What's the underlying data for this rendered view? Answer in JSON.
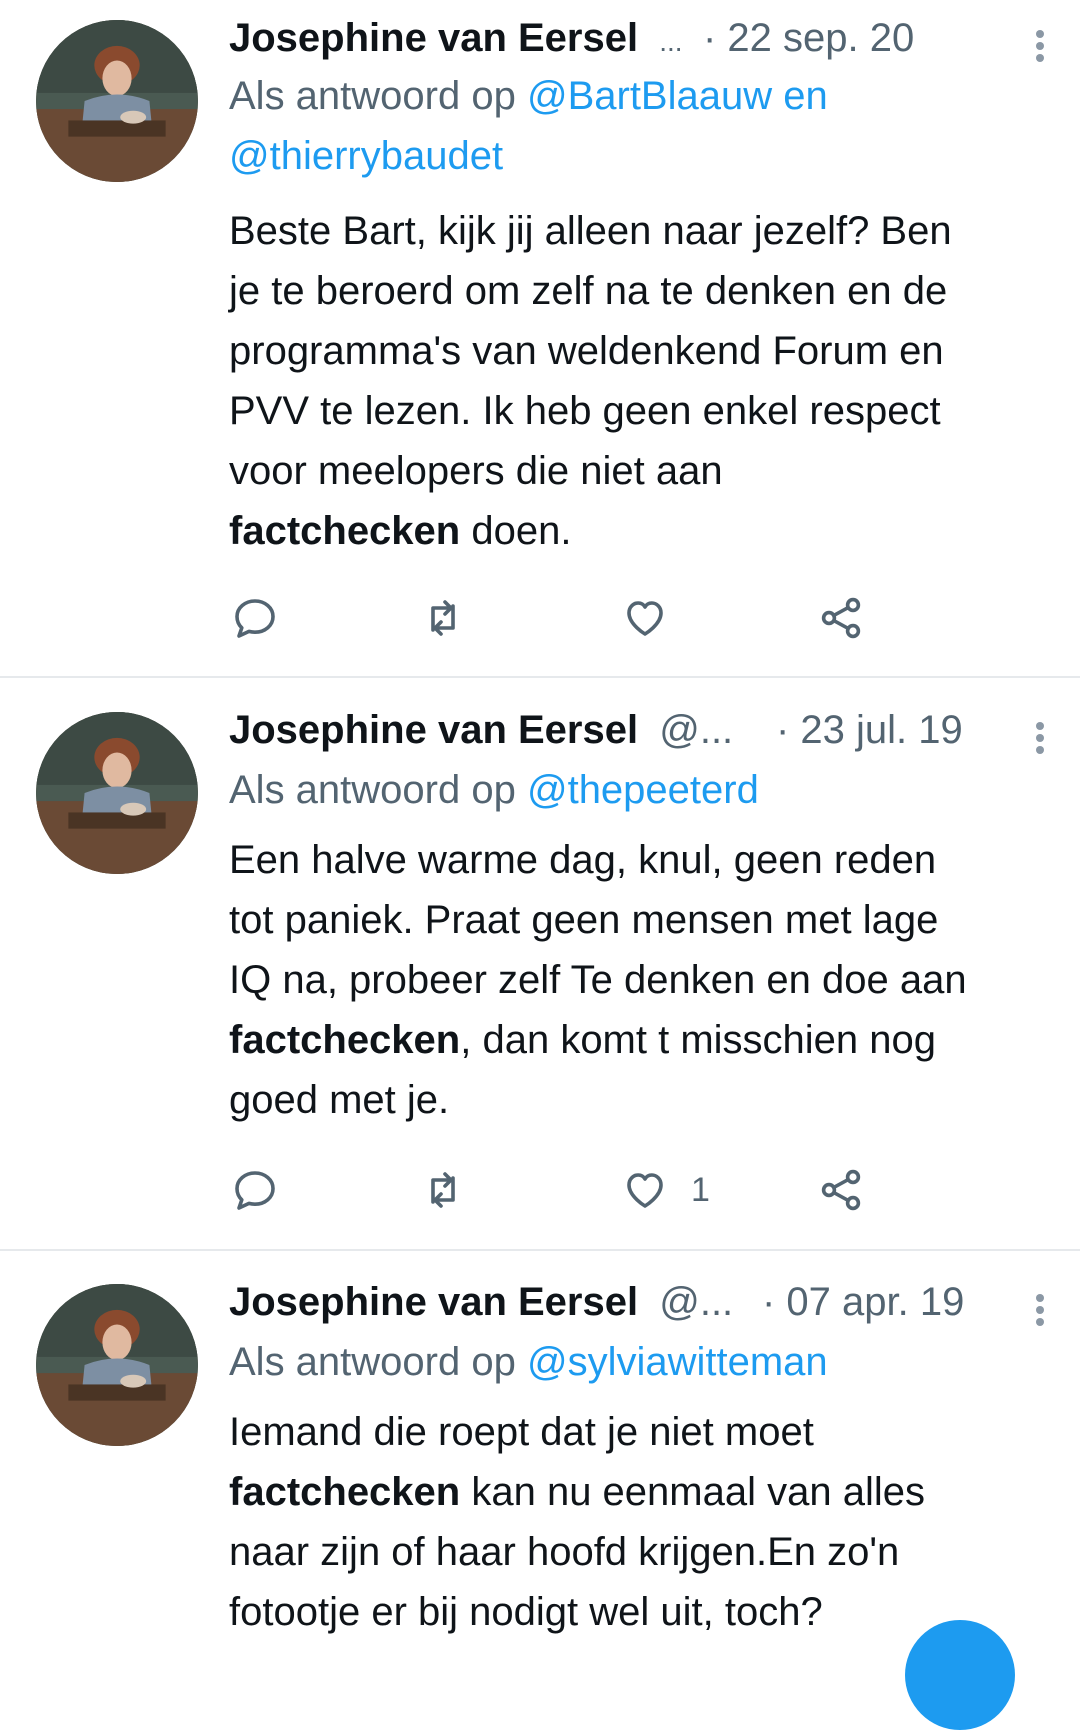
{
  "tweets": [
    {
      "name": "Josephine van Eersel",
      "handle": "...",
      "date": "· 22 sep. 20",
      "reply_prefix": "Als antwoord op",
      "reply_mentions_line1": "@BartBlaauw en",
      "reply_mentions_line2": "@thierrybaudet",
      "text_lines": [
        "Beste Bart, kijk jij alleen naar jezelf? Ben",
        "je te beroerd  om zelf na te denken en de",
        "programma's  van weldenkend Forum en",
        "PVV te lezen. Ik heb geen enkel respect",
        "voor meelopers die niet aan"
      ],
      "text_bold": "factchecken",
      "text_after_bold": " doen.",
      "likes": ""
    },
    {
      "name": "Josephine van Eersel",
      "handle": "@...",
      "date": "· 23 jul. 19",
      "reply_prefix": "Als antwoord op",
      "reply_mentions_line1": "@thepeeterd",
      "text_lines": [
        "Een halve warme dag, knul, geen reden",
        "tot paniek. Praat geen mensen met lage",
        "IQ na, probeer zelf Te denken en doe aan"
      ],
      "text_bold": "factchecken",
      "text_after_bold": ", dan komt t misschien nog",
      "text_tail": "goed met je.",
      "likes": "1"
    },
    {
      "name": "Josephine van Eersel",
      "handle": "@...",
      "date": "· 07 apr. 19",
      "reply_prefix": "Als antwoord op",
      "reply_mentions_line1": "@sylviawitteman",
      "text_first": "Iemand die roept dat je niet moet",
      "text_bold": "factchecken",
      "text_after_bold": " kan nu eenmaal van alles",
      "text_lines": [
        "naar zijn of haar hoofd krijgen.En zo'n",
        "fotootje er bij nodigt wel uit, toch?"
      ]
    }
  ],
  "icons": {
    "reply": "reply-icon",
    "retweet": "retweet-icon",
    "like": "heart-icon",
    "share": "share-icon",
    "more": "more-vertical-icon",
    "compose": "compose-fab"
  },
  "colors": {
    "link": "#1d9bf0",
    "secondary": "#536471",
    "text": "#0f1419",
    "divider": "#e6e9ec"
  }
}
